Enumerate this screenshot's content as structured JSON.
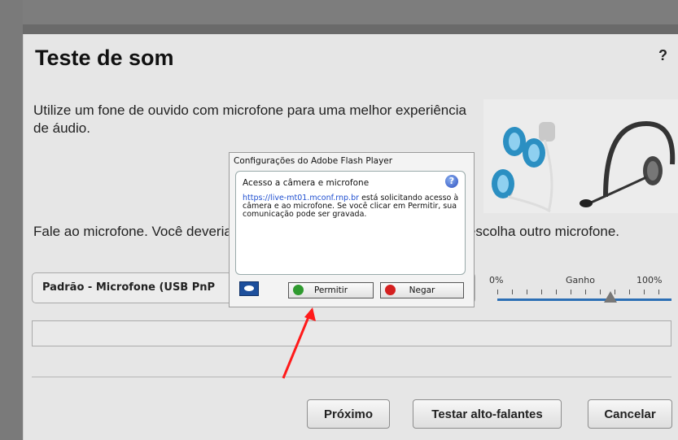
{
  "dialog": {
    "title": "Teste de som",
    "help_label": "?",
    "intro_text": "Utilize um fone de ouvido com microfone para uma melhor experiência de áudio.",
    "speak_text": "Fale ao microfone. Você deveria ver a barra se mover. Caso contrário, escolha outro microfone.",
    "microphone_select": {
      "selected": "Padrão - Microfone (USB PnP"
    },
    "gain": {
      "min_label": "0%",
      "label": "Ganho",
      "max_label": "100%",
      "level_percent": 65
    },
    "buttons": {
      "next": "Próximo",
      "test_speakers": "Testar alto-falantes",
      "cancel": "Cancelar"
    }
  },
  "flash_dialog": {
    "title": "Configurações do Adobe Flash Player",
    "heading": "Acesso a câmera e microfone",
    "url": "https://live-mt01.mconf.rnp.br",
    "message": "está solicitando acesso à câmera e ao microfone. Se você clicar em Permitir, sua comunicação pode ser gravada.",
    "allow_label": "Permitir",
    "deny_label": "Negar",
    "info_icon": "help-info-icon",
    "monitor_icon": "privacy-monitor-icon"
  },
  "annotation": {
    "arrow_color": "#ff1a1a"
  }
}
